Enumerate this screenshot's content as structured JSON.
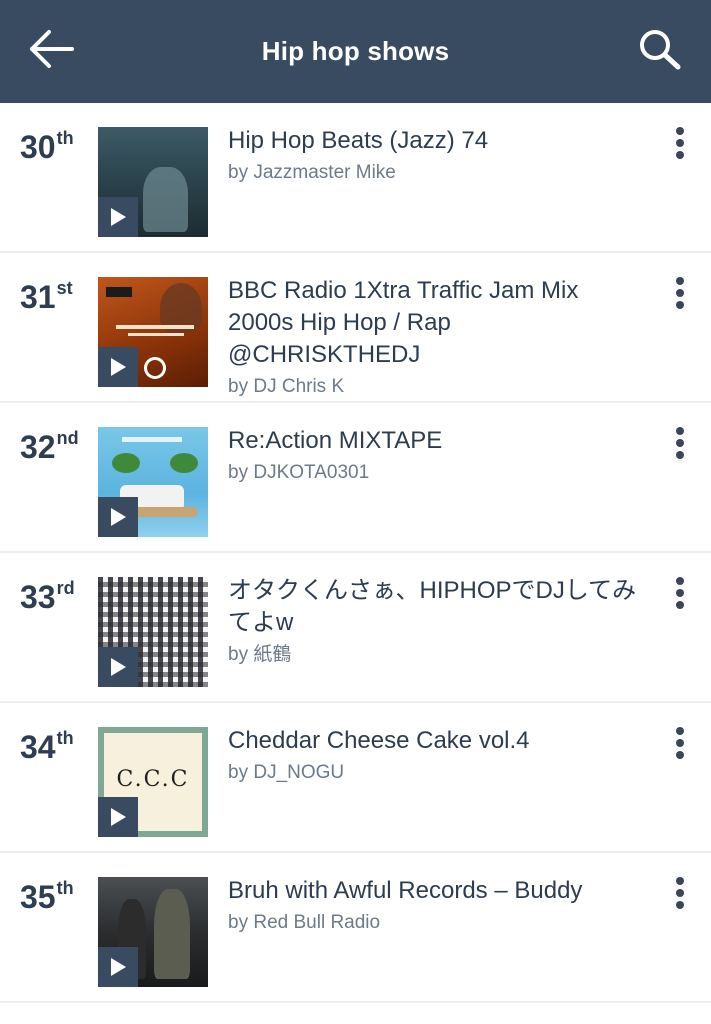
{
  "header": {
    "title": "Hip hop shows",
    "back_icon": "back-arrow-icon",
    "search_icon": "search-icon",
    "color": "#394b61"
  },
  "shows": [
    {
      "rank": "30",
      "suffix": "th",
      "title": "Hip Hop Beats (Jazz) 74",
      "by": "by Jazzmaster Mike",
      "art": "city"
    },
    {
      "rank": "31",
      "suffix": "st",
      "title": "BBC Radio 1Xtra Traffic Jam Mix 2000s Hip Hop / Rap @CHRISKTHEDJ",
      "by": "by DJ Chris K",
      "art": "bbc"
    },
    {
      "rank": "32",
      "suffix": "nd",
      "title": "Re:Action MIXTAPE",
      "by": "by DJKOTA0301",
      "art": "reaction"
    },
    {
      "rank": "33",
      "suffix": "rd",
      "title": "オタクくんさぁ、HIPHOPでDJしてみてよw",
      "by": "by 紙鶴",
      "art": "check"
    },
    {
      "rank": "34",
      "suffix": "th",
      "title": "Cheddar Cheese Cake vol.4",
      "by": "by DJ_NOGU",
      "art": "ccc",
      "art_text": "C.C.C"
    },
    {
      "rank": "35",
      "suffix": "th",
      "title": "Bruh with Awful Records – Buddy",
      "by": "by Red Bull Radio",
      "art": "photo"
    }
  ]
}
